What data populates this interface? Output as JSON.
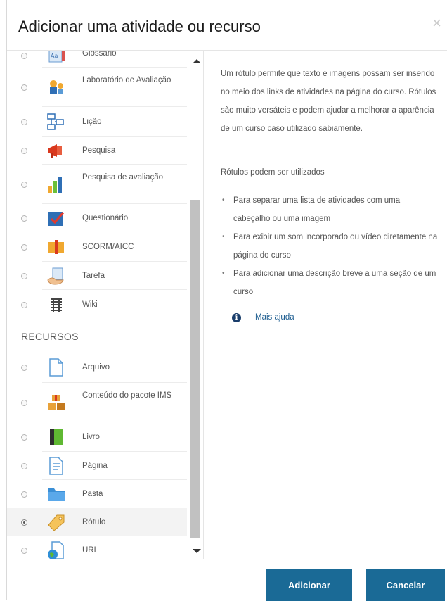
{
  "dialog": {
    "title": "Adicionar uma atividade ou recurso",
    "close_glyph": "×"
  },
  "activities": [
    {
      "label": "Glossário",
      "icon": "glossary-icon",
      "selected": false
    },
    {
      "label": "Laboratório de Avaliação",
      "icon": "workshop-icon",
      "selected": false
    },
    {
      "label": "Lição",
      "icon": "lesson-icon",
      "selected": false
    },
    {
      "label": "Pesquisa",
      "icon": "survey-icon",
      "selected": false
    },
    {
      "label": "Pesquisa de avaliação",
      "icon": "feedback-icon",
      "selected": false
    },
    {
      "label": "Questionário",
      "icon": "quiz-icon",
      "selected": false
    },
    {
      "label": "SCORM/AICC",
      "icon": "scorm-icon",
      "selected": false
    },
    {
      "label": "Tarefa",
      "icon": "assignment-icon",
      "selected": false
    },
    {
      "label": "Wiki",
      "icon": "wiki-icon",
      "selected": false
    }
  ],
  "resources_heading": "RECURSOS",
  "resources": [
    {
      "label": "Arquivo",
      "icon": "file-icon",
      "selected": false
    },
    {
      "label": "Conteúdo do pacote IMS",
      "icon": "ims-package-icon",
      "selected": false
    },
    {
      "label": "Livro",
      "icon": "book-icon",
      "selected": false
    },
    {
      "label": "Página",
      "icon": "page-icon",
      "selected": false
    },
    {
      "label": "Pasta",
      "icon": "folder-icon",
      "selected": false
    },
    {
      "label": "Rótulo",
      "icon": "label-icon",
      "selected": true
    },
    {
      "label": "URL",
      "icon": "url-icon",
      "selected": false
    }
  ],
  "help": {
    "description": "Um rótulo permite que texto e imagens possam ser inserido no meio dos links de atividades na página do curso. Rótulos são muito versáteis e podem ajudar a melhorar a aparência de um curso caso utilizado sabiamente.",
    "usage_title": "Rótulos podem ser utilizados",
    "bullets": [
      "Para separar uma lista de atividades com uma cabeçalho ou uma imagem",
      "Para exibir um som incorporado ou vídeo diretamente na página do curso",
      "Para adicionar uma descrição breve a uma seção de um curso"
    ],
    "more_help": "Mais ajuda"
  },
  "buttons": {
    "add": "Adicionar",
    "cancel": "Cancelar"
  },
  "colors": {
    "primary_button": "#1a6a96",
    "link": "#1d5d90"
  }
}
